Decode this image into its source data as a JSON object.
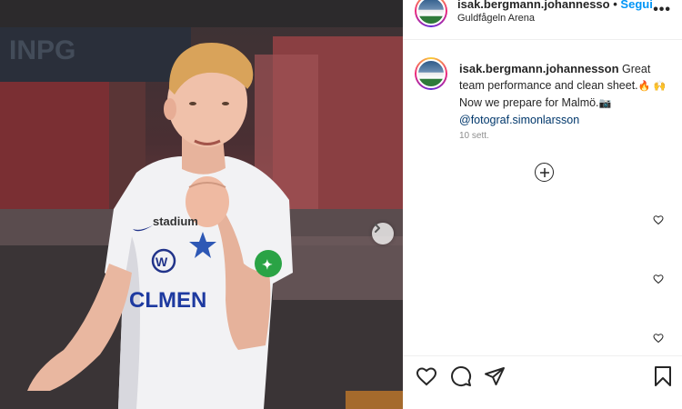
{
  "post": {
    "username": "isak.bergmann.johannesso",
    "separator": "•",
    "follow_label": "Segui",
    "location": "Guldfågeln Arena",
    "more_label": "•••"
  },
  "caption": {
    "username": "isak.bergmann.johannesson",
    "text_1": "Great team performance and clean sheet.",
    "emoji_1": "🔥",
    "emoji_2": "🙌",
    "text_2": "Now we prepare for Malmö.",
    "emoji_3": "📷",
    "mention": "@fotograf.simonlarsson",
    "time": "10 sett."
  },
  "photo": {
    "shirt_sponsor": "CLMEN",
    "shirt_brand": "stadium"
  },
  "icons": [
    "like-icon",
    "comment-icon",
    "share-icon",
    "save-icon",
    "more-icon",
    "next-icon",
    "load-more-icon",
    "comment-like-icon"
  ],
  "colors": {
    "accent": "#0095f6",
    "mention": "#00376b",
    "muted": "#8e8e8e",
    "text": "#262626"
  }
}
